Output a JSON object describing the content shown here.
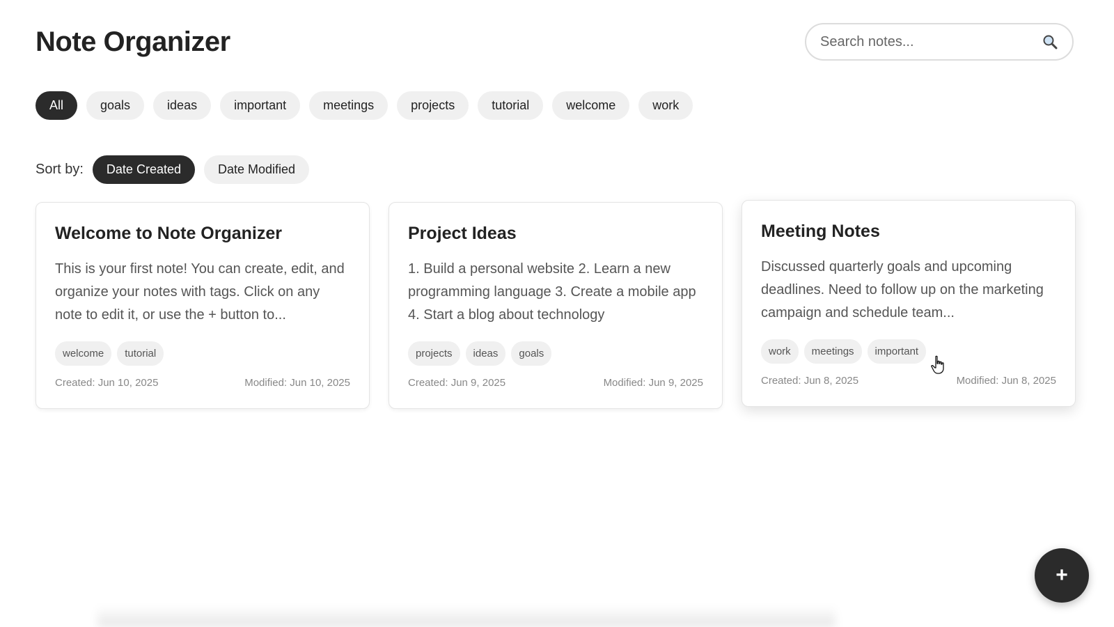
{
  "app": {
    "title": "Note Organizer"
  },
  "search": {
    "placeholder": "Search notes..."
  },
  "filters": {
    "items": [
      {
        "label": "All",
        "active": true
      },
      {
        "label": "goals",
        "active": false
      },
      {
        "label": "ideas",
        "active": false
      },
      {
        "label": "important",
        "active": false
      },
      {
        "label": "meetings",
        "active": false
      },
      {
        "label": "projects",
        "active": false
      },
      {
        "label": "tutorial",
        "active": false
      },
      {
        "label": "welcome",
        "active": false
      },
      {
        "label": "work",
        "active": false
      }
    ]
  },
  "sort": {
    "label": "Sort by:",
    "options": [
      {
        "label": "Date Created",
        "active": true
      },
      {
        "label": "Date Modified",
        "active": false
      }
    ]
  },
  "notes": [
    {
      "title": "Welcome to Note Organizer",
      "body": "This is your first note! You can create, edit, and organize your notes with tags. Click on any note to edit it, or use the + button to...",
      "tags": [
        "welcome",
        "tutorial"
      ],
      "created": "Created: Jun 10, 2025",
      "modified": "Modified: Jun 10, 2025"
    },
    {
      "title": "Project Ideas",
      "body": "1. Build a personal website 2. Learn a new programming language 3. Create a mobile app 4. Start a blog about technology",
      "tags": [
        "projects",
        "ideas",
        "goals"
      ],
      "created": "Created: Jun 9, 2025",
      "modified": "Modified: Jun 9, 2025"
    },
    {
      "title": "Meeting Notes",
      "body": "Discussed quarterly goals and upcoming deadlines. Need to follow up on the marketing campaign and schedule team...",
      "tags": [
        "work",
        "meetings",
        "important"
      ],
      "created": "Created: Jun 8, 2025",
      "modified": "Modified: Jun 8, 2025"
    }
  ],
  "fab": {
    "label": "+"
  },
  "colors": {
    "accent_dark": "#2b2b2b",
    "chip_bg": "#f0f0f0",
    "page_bg": "#ffffff"
  },
  "icons": {
    "search": "search-icon",
    "add": "plus-icon",
    "cursor": "hand-pointer-icon"
  }
}
